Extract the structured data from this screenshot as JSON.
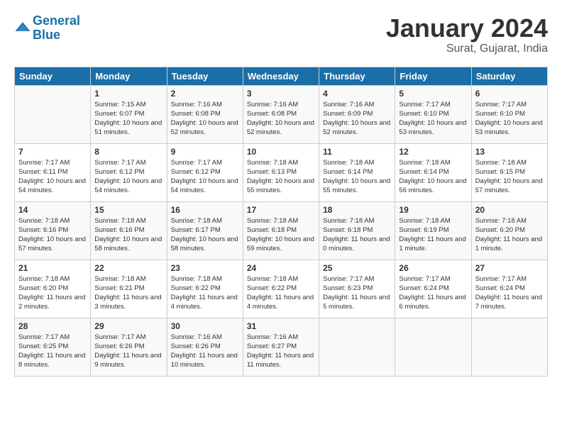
{
  "logo": {
    "text_general": "General",
    "text_blue": "Blue"
  },
  "header": {
    "title": "January 2024",
    "subtitle": "Surat, Gujarat, India"
  },
  "columns": [
    "Sunday",
    "Monday",
    "Tuesday",
    "Wednesday",
    "Thursday",
    "Friday",
    "Saturday"
  ],
  "weeks": [
    [
      {
        "day": "",
        "sunrise": "",
        "sunset": "",
        "daylight": ""
      },
      {
        "day": "1",
        "sunrise": "Sunrise: 7:15 AM",
        "sunset": "Sunset: 6:07 PM",
        "daylight": "Daylight: 10 hours and 51 minutes."
      },
      {
        "day": "2",
        "sunrise": "Sunrise: 7:16 AM",
        "sunset": "Sunset: 6:08 PM",
        "daylight": "Daylight: 10 hours and 52 minutes."
      },
      {
        "day": "3",
        "sunrise": "Sunrise: 7:16 AM",
        "sunset": "Sunset: 6:08 PM",
        "daylight": "Daylight: 10 hours and 52 minutes."
      },
      {
        "day": "4",
        "sunrise": "Sunrise: 7:16 AM",
        "sunset": "Sunset: 6:09 PM",
        "daylight": "Daylight: 10 hours and 52 minutes."
      },
      {
        "day": "5",
        "sunrise": "Sunrise: 7:17 AM",
        "sunset": "Sunset: 6:10 PM",
        "daylight": "Daylight: 10 hours and 53 minutes."
      },
      {
        "day": "6",
        "sunrise": "Sunrise: 7:17 AM",
        "sunset": "Sunset: 6:10 PM",
        "daylight": "Daylight: 10 hours and 53 minutes."
      }
    ],
    [
      {
        "day": "7",
        "sunrise": "Sunrise: 7:17 AM",
        "sunset": "Sunset: 6:11 PM",
        "daylight": "Daylight: 10 hours and 54 minutes."
      },
      {
        "day": "8",
        "sunrise": "Sunrise: 7:17 AM",
        "sunset": "Sunset: 6:12 PM",
        "daylight": "Daylight: 10 hours and 54 minutes."
      },
      {
        "day": "9",
        "sunrise": "Sunrise: 7:17 AM",
        "sunset": "Sunset: 6:12 PM",
        "daylight": "Daylight: 10 hours and 54 minutes."
      },
      {
        "day": "10",
        "sunrise": "Sunrise: 7:18 AM",
        "sunset": "Sunset: 6:13 PM",
        "daylight": "Daylight: 10 hours and 55 minutes."
      },
      {
        "day": "11",
        "sunrise": "Sunrise: 7:18 AM",
        "sunset": "Sunset: 6:14 PM",
        "daylight": "Daylight: 10 hours and 55 minutes."
      },
      {
        "day": "12",
        "sunrise": "Sunrise: 7:18 AM",
        "sunset": "Sunset: 6:14 PM",
        "daylight": "Daylight: 10 hours and 56 minutes."
      },
      {
        "day": "13",
        "sunrise": "Sunrise: 7:18 AM",
        "sunset": "Sunset: 6:15 PM",
        "daylight": "Daylight: 10 hours and 57 minutes."
      }
    ],
    [
      {
        "day": "14",
        "sunrise": "Sunrise: 7:18 AM",
        "sunset": "Sunset: 6:16 PM",
        "daylight": "Daylight: 10 hours and 57 minutes."
      },
      {
        "day": "15",
        "sunrise": "Sunrise: 7:18 AM",
        "sunset": "Sunset: 6:16 PM",
        "daylight": "Daylight: 10 hours and 58 minutes."
      },
      {
        "day": "16",
        "sunrise": "Sunrise: 7:18 AM",
        "sunset": "Sunset: 6:17 PM",
        "daylight": "Daylight: 10 hours and 58 minutes."
      },
      {
        "day": "17",
        "sunrise": "Sunrise: 7:18 AM",
        "sunset": "Sunset: 6:18 PM",
        "daylight": "Daylight: 10 hours and 59 minutes."
      },
      {
        "day": "18",
        "sunrise": "Sunrise: 7:18 AM",
        "sunset": "Sunset: 6:18 PM",
        "daylight": "Daylight: 11 hours and 0 minutes."
      },
      {
        "day": "19",
        "sunrise": "Sunrise: 7:18 AM",
        "sunset": "Sunset: 6:19 PM",
        "daylight": "Daylight: 11 hours and 1 minute."
      },
      {
        "day": "20",
        "sunrise": "Sunrise: 7:18 AM",
        "sunset": "Sunset: 6:20 PM",
        "daylight": "Daylight: 11 hours and 1 minute."
      }
    ],
    [
      {
        "day": "21",
        "sunrise": "Sunrise: 7:18 AM",
        "sunset": "Sunset: 6:20 PM",
        "daylight": "Daylight: 11 hours and 2 minutes."
      },
      {
        "day": "22",
        "sunrise": "Sunrise: 7:18 AM",
        "sunset": "Sunset: 6:21 PM",
        "daylight": "Daylight: 11 hours and 3 minutes."
      },
      {
        "day": "23",
        "sunrise": "Sunrise: 7:18 AM",
        "sunset": "Sunset: 6:22 PM",
        "daylight": "Daylight: 11 hours and 4 minutes."
      },
      {
        "day": "24",
        "sunrise": "Sunrise: 7:18 AM",
        "sunset": "Sunset: 6:22 PM",
        "daylight": "Daylight: 11 hours and 4 minutes."
      },
      {
        "day": "25",
        "sunrise": "Sunrise: 7:17 AM",
        "sunset": "Sunset: 6:23 PM",
        "daylight": "Daylight: 11 hours and 5 minutes."
      },
      {
        "day": "26",
        "sunrise": "Sunrise: 7:17 AM",
        "sunset": "Sunset: 6:24 PM",
        "daylight": "Daylight: 11 hours and 6 minutes."
      },
      {
        "day": "27",
        "sunrise": "Sunrise: 7:17 AM",
        "sunset": "Sunset: 6:24 PM",
        "daylight": "Daylight: 11 hours and 7 minutes."
      }
    ],
    [
      {
        "day": "28",
        "sunrise": "Sunrise: 7:17 AM",
        "sunset": "Sunset: 6:25 PM",
        "daylight": "Daylight: 11 hours and 8 minutes."
      },
      {
        "day": "29",
        "sunrise": "Sunrise: 7:17 AM",
        "sunset": "Sunset: 6:26 PM",
        "daylight": "Daylight: 11 hours and 9 minutes."
      },
      {
        "day": "30",
        "sunrise": "Sunrise: 7:16 AM",
        "sunset": "Sunset: 6:26 PM",
        "daylight": "Daylight: 11 hours and 10 minutes."
      },
      {
        "day": "31",
        "sunrise": "Sunrise: 7:16 AM",
        "sunset": "Sunset: 6:27 PM",
        "daylight": "Daylight: 11 hours and 11 minutes."
      },
      {
        "day": "",
        "sunrise": "",
        "sunset": "",
        "daylight": ""
      },
      {
        "day": "",
        "sunrise": "",
        "sunset": "",
        "daylight": ""
      },
      {
        "day": "",
        "sunrise": "",
        "sunset": "",
        "daylight": ""
      }
    ]
  ]
}
